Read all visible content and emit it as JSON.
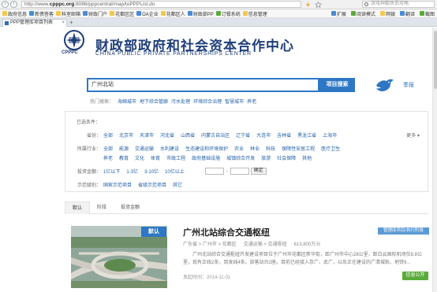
{
  "browser": {
    "url_prefix": "http://www.",
    "url_domain": "cpppc.org",
    "url_suffix": ":8086/pppcentral/map/toPPPList.do",
    "search_placeholder": "游戏神鹏侠侣攻略",
    "tab_title": "PPP管理库项目列表",
    "tab_close": "×",
    "new_tab": "+",
    "favorites": [
      "政府信息",
      "新债答客",
      "科室邮箱",
      "财政门户",
      "花都区区",
      "OA企业",
      "花都区人",
      "财政部PP",
      "订餐系统",
      "信息管理"
    ],
    "favorites_right": [
      "扩展",
      "阅读模式",
      "网银",
      "翻译",
      "截图"
    ]
  },
  "header": {
    "title": "财政部政府和社会资本合作中心",
    "subtitle": "CHINA PUBLIC PRIVATE PARTNERSHIPS CENTER",
    "logo_text": "CPPPC"
  },
  "search": {
    "query": "广州北站",
    "button": "项目搜索",
    "season_label": "季报",
    "hot_label": "热门搜索：",
    "hot_words": [
      "海绵城市",
      "地下综合管廊",
      "污水处理",
      "环境综合治理",
      "智慧城市",
      "养老"
    ]
  },
  "filters": {
    "selected_label": "已选条件：",
    "more_label": "更多",
    "province": {
      "label": "省份：",
      "options": [
        "全部",
        "北京市",
        "天津市",
        "河北省",
        "山西省",
        "内蒙古自治区",
        "辽宁省",
        "大连市",
        "吉林省",
        "黑龙江省",
        "上海市"
      ]
    },
    "industry": {
      "label": "所属行业：",
      "row1": [
        "全部",
        "能源",
        "交通运输",
        "水利建设",
        "生态建设和环境保护",
        "农业",
        "林业",
        "科技",
        "保障性安居工程",
        "医疗卫生"
      ],
      "row2": [
        "养老",
        "教育",
        "文化",
        "体育",
        "市政工程",
        "政府基础设施",
        "城镇综合开发",
        "旅游",
        "社会保障",
        "其他"
      ]
    },
    "investment": {
      "label": "投资金额：",
      "options": [
        "1亿以下",
        "1-3亿",
        "3-10亿",
        "10亿以上"
      ],
      "range_sep": "-",
      "confirm": "确定"
    },
    "demo": {
      "label": "示范级别：",
      "options": [
        "国家示范项目",
        "省级示范项目",
        "其它"
      ]
    }
  },
  "result_tabs": [
    "默认",
    "阶段",
    "投资金额"
  ],
  "result": {
    "badge": "默认",
    "title": "广州北站综合交通枢纽",
    "library_badge": "管理库项目/执行阶段",
    "region": "广东省 > 广州市 > 花都区",
    "industry": "交通运输 > 交通枢纽",
    "amount": "613,800万元",
    "description": "广州北站综合交通枢纽开发建设项目位于广州市花都区新华街，距广州市中心28公里，距白云国际机场仅8.8公里，现有正线2条，到发线4条。旅客站台2座。目前已经接入京广、武广，以及正在建设的广清城轨、地铁9...",
    "date_label": "发起时间：",
    "date": "2014-11-01",
    "info_button": "信息公开"
  },
  "colors": {
    "accent": "#2d77c5",
    "brand_dark": "#1f3f7a",
    "link": "#1f5fa8",
    "green": "#5aaa3a",
    "lib_badge": "#5b9bd5"
  }
}
